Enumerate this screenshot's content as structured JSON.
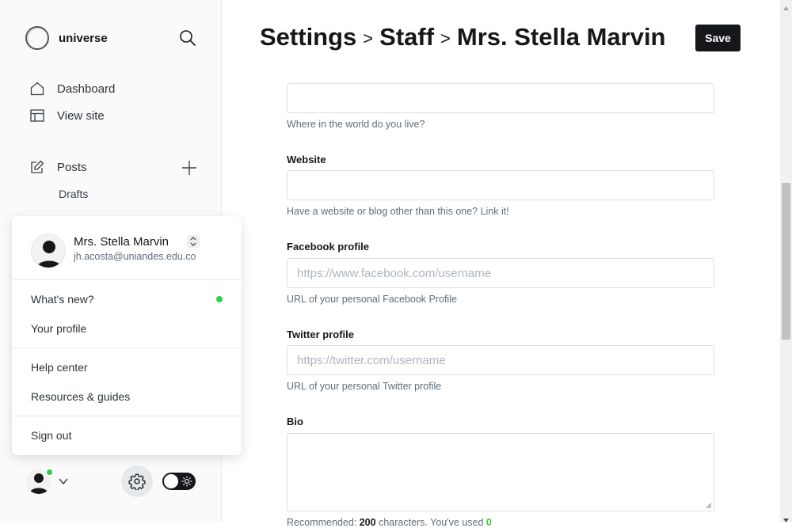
{
  "sidebar": {
    "brand_name": "universe",
    "nav": {
      "dashboard": "Dashboard",
      "view_site": "View site",
      "posts": "Posts",
      "drafts": "Drafts"
    }
  },
  "user_menu": {
    "name": "Mrs. Stella Marvin",
    "email": "jh.acosta@uniandes.edu.co",
    "items": {
      "whats_new": "What's new?",
      "your_profile": "Your profile",
      "help_center": "Help center",
      "resources": "Resources & guides",
      "sign_out": "Sign out"
    },
    "whats_new_dot_color": "#30cf43"
  },
  "header": {
    "crumb_1": "Settings",
    "crumb_2": "Staff",
    "crumb_3": "Mrs. Stella Marvin",
    "save_label": "Save"
  },
  "form": {
    "location": {
      "value": "",
      "help": "Where in the world do you live?"
    },
    "website": {
      "label": "Website",
      "value": "",
      "help": "Have a website or blog other than this one? Link it!"
    },
    "facebook": {
      "label": "Facebook profile",
      "placeholder": "https://www.facebook.com/username",
      "help": "URL of your personal Facebook Profile"
    },
    "twitter": {
      "label": "Twitter profile",
      "placeholder": "https://twitter.com/username",
      "help": "URL of your personal Twitter profile"
    },
    "bio": {
      "label": "Bio",
      "value": "",
      "help_prefix": "Recommended:",
      "help_limit": "200",
      "help_middle": "characters. You've used",
      "help_count": "0"
    }
  },
  "colors": {
    "accent": "#15171a",
    "status_green": "#30cf43"
  },
  "icons": [
    "search-icon",
    "home-icon",
    "layout-icon",
    "edit-icon",
    "plus-icon",
    "gear-icon",
    "sun-icon",
    "chevron-down-icon",
    "switch-icon"
  ]
}
